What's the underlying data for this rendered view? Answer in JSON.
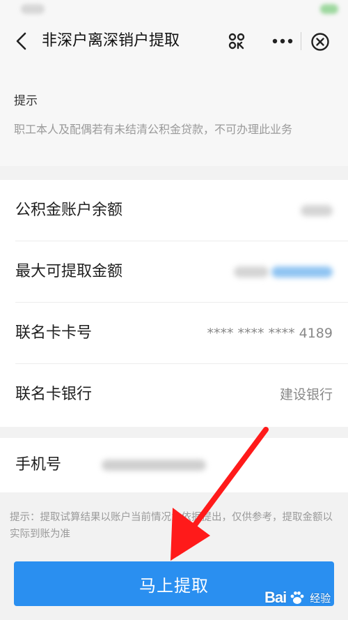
{
  "nav": {
    "title": "非深户离深销户提取",
    "back_icon": "chevron-left-icon",
    "scan_icon": "scan-icon",
    "more_icon": "more-dots-icon",
    "close_icon": "close-circle-icon"
  },
  "notice": {
    "title": "提示",
    "text": "职工本人及配偶若有未结清公积金贷款，不可办理此业务"
  },
  "info_rows": [
    {
      "label": "公积金账户余额",
      "value": ""
    },
    {
      "label": "最大可提取金额",
      "value": ""
    },
    {
      "label": "联名卡卡号",
      "value": "**** **** **** 4189"
    },
    {
      "label": "联名卡银行",
      "value": "建设银行"
    }
  ],
  "phone_row": {
    "label": "手机号",
    "value": ""
  },
  "hint": "提示：提取试算结果以账户当前情况为依据提出，仅供参考，提取金额以实际到账为准",
  "submit": {
    "label": "马上提取"
  },
  "watermark": {
    "bai": "Bai",
    "jingyan": "经验"
  },
  "colors": {
    "primary_button": "#2a8ff0",
    "annotation_arrow": "#ff1a1a",
    "link_blue": "#8fc4f2",
    "muted_text": "#9a9a9a",
    "background": "#f2f2f2"
  }
}
